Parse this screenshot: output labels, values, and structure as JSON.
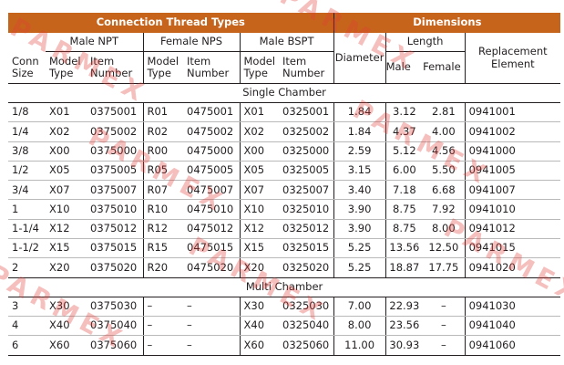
{
  "header": {
    "connection_thread_types": "Connection Thread Types",
    "dimensions": "Dimensions"
  },
  "subheader": {
    "male_npt": "Male NPT",
    "female_nps": "Female NPS",
    "male_bspt": "Male BSPT",
    "diameter": "Diameter",
    "length": "Length",
    "replacement_element": "Replacement Element",
    "conn_size": "Conn Size",
    "model_type": "Model Type",
    "item_number": "Item Number",
    "male": "Male",
    "female": "Female"
  },
  "sections": {
    "single": "Single Chamber",
    "multi": "Multi Chamber"
  },
  "single_rows": [
    [
      "1/8",
      "X01",
      "0375001",
      "R01",
      "0475001",
      "X01",
      "0325001",
      "1.84",
      "3.12",
      "2.81",
      "0941001"
    ],
    [
      "1/4",
      "X02",
      "0375002",
      "R02",
      "0475002",
      "X02",
      "0325002",
      "1.84",
      "4.37",
      "4.00",
      "0941002"
    ],
    [
      "3/8",
      "X00",
      "0375000",
      "R00",
      "0475000",
      "X00",
      "0325000",
      "2.59",
      "5.12",
      "4.56",
      "0941000"
    ],
    [
      "1/2",
      "X05",
      "0375005",
      "R05",
      "0475005",
      "X05",
      "0325005",
      "3.15",
      "6.00",
      "5.50",
      "0941005"
    ],
    [
      "3/4",
      "X07",
      "0375007",
      "R07",
      "0475007",
      "X07",
      "0325007",
      "3.40",
      "7.18",
      "6.68",
      "0941007"
    ],
    [
      "1",
      "X10",
      "0375010",
      "R10",
      "0475010",
      "X10",
      "0325010",
      "3.90",
      "8.75",
      "7.92",
      "0941010"
    ],
    [
      "1-1/4",
      "X12",
      "0375012",
      "R12",
      "0475012",
      "X12",
      "0325012",
      "3.90",
      "8.75",
      "8.00",
      "0941012"
    ],
    [
      "1-1/2",
      "X15",
      "0375015",
      "R15",
      "0475015",
      "X15",
      "0325015",
      "5.25",
      "13.56",
      "12.50",
      "0941015"
    ],
    [
      "2",
      "X20",
      "0375020",
      "R20",
      "0475020",
      "X20",
      "0325020",
      "5.25",
      "18.87",
      "17.75",
      "0941020"
    ]
  ],
  "multi_rows": [
    [
      "3",
      "X30",
      "0375030",
      "–",
      "–",
      "X30",
      "0325030",
      "7.00",
      "22.93",
      "–",
      "0941030"
    ],
    [
      "4",
      "X40",
      "0375040",
      "–",
      "–",
      "X40",
      "0325040",
      "8.00",
      "23.56",
      "–",
      "0941040"
    ],
    [
      "6",
      "X60",
      "0375060",
      "–",
      "–",
      "X60",
      "0325060",
      "11.00",
      "30.93",
      "–",
      "0941060"
    ]
  ],
  "watermark": "PARMEX",
  "colors": {
    "header_fill": "#c7641b",
    "header_text": "#ffffff",
    "watermark": "#e23c37"
  }
}
